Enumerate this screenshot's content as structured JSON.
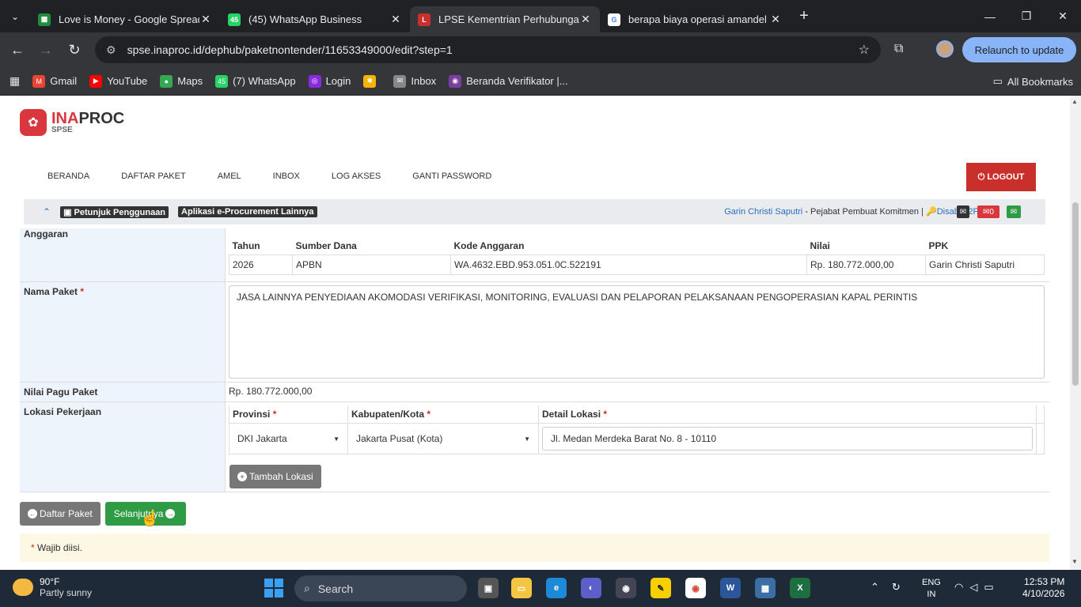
{
  "browser": {
    "tabs": [
      {
        "title": "Love is Money - Google Spread",
        "icon_color": "#1e8e3e",
        "icon": "sheets-icon"
      },
      {
        "title": "(45) WhatsApp Business",
        "icon_color": "#25d366",
        "icon": "whatsapp-icon"
      },
      {
        "title": "LPSE Kementrian Perhubungan",
        "icon_color": "#c9302c",
        "icon": "lpse-icon"
      },
      {
        "title": "berapa biaya operasi amandel",
        "icon_color": "#4285f4",
        "icon": "google-icon"
      }
    ],
    "url": "spse.inaproc.id/dephub/paketnontender/11653349000/edit?step=1",
    "relaunch_label": "Relaunch to update",
    "bookmarks": [
      {
        "label": "Gmail",
        "color": "#ea4335"
      },
      {
        "label": "YouTube",
        "color": "#ff0000"
      },
      {
        "label": "Maps",
        "color": "#34a853"
      },
      {
        "label": "(7) WhatsApp",
        "color": "#25d366"
      },
      {
        "label": "Login",
        "color": "#8a2be2"
      },
      {
        "label": "Inbox",
        "color": "#888888"
      },
      {
        "label": "Beranda Verifikator |...",
        "color": "#7b3fa0"
      }
    ],
    "all_bookmarks": "All Bookmarks"
  },
  "site": {
    "logo_title_red": "INA",
    "logo_title_dark": "PROC",
    "logo_sub": "SPSE",
    "nav": [
      "BERANDA",
      "DAFTAR PAKET",
      "AMEL",
      "INBOX",
      "LOG AKSES",
      "GANTI PASSWORD"
    ],
    "logout": "LOGOUT",
    "petunjuk": "Petunjuk Penggunaan",
    "aplikasi": "Aplikasi e-Procurement Lainnya",
    "user_name": "Garin Christi Saputri",
    "user_role": " - Pejabat Pembuat Komitmen | ",
    "disable_2fa": "Disable 2FA",
    "mail_count": "0"
  },
  "form": {
    "anggaran_label": "Anggaran",
    "anggaran_headers": [
      "Tahun",
      "Sumber Dana",
      "Kode Anggaran",
      "Nilai",
      "PPK"
    ],
    "anggaran_row": [
      "2026",
      "APBN",
      "WA.4632.EBD.953.051.0C.522191",
      "Rp. 180.772.000,00",
      "Garin Christi Saputri"
    ],
    "nama_paket_label": "Nama Paket",
    "nama_paket_value": "JASA LAINNYA PENYEDIAAN AKOMODASI VERIFIKASI, MONITORING, EVALUASI DAN PELAPORAN PELAKSANAAN PENGOPERASIAN KAPAL PERINTIS",
    "nilai_pagu_label": "Nilai Pagu Paket",
    "nilai_pagu_value": "Rp. 180.772.000,00",
    "lokasi_label": "Lokasi Pekerjaan",
    "provinsi_label": "Provinsi",
    "kabupaten_label": "Kabupaten/Kota",
    "detail_label": "Detail Lokasi",
    "provinsi_value": "DKI Jakarta",
    "kabupaten_value": "Jakarta Pusat (Kota)",
    "detail_value": "Jl. Medan Merdeka Barat No. 8 - 10110",
    "tambah_lokasi": "Tambah Lokasi",
    "daftar_paket": "Daftar Paket",
    "selanjutnya": "Selanjutnya",
    "wajib": "Wajib diisi."
  },
  "taskbar": {
    "temp": "90°F",
    "weather": "Partly sunny",
    "search": "Search",
    "lang1": "ENG",
    "lang2": "IN",
    "time": "12:53 PM",
    "date": "4/10/2026"
  }
}
